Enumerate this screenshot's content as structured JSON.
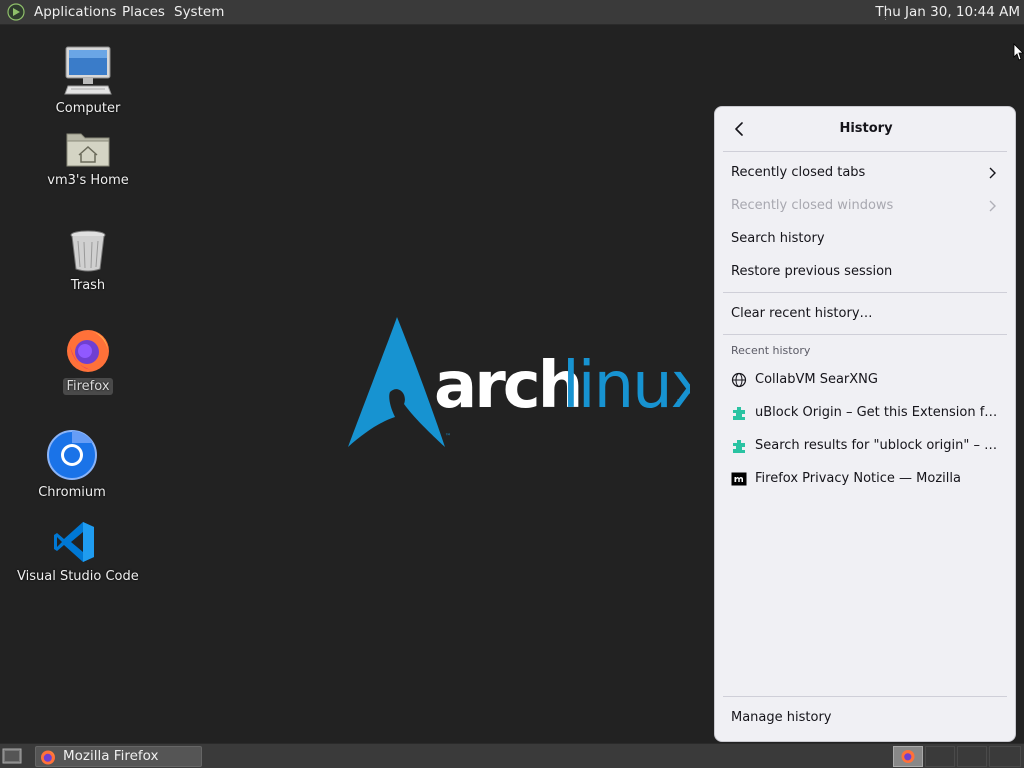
{
  "top_panel": {
    "menu": [
      "Applications",
      "Places",
      "System"
    ],
    "clock": "Thu Jan 30, 10:44 AM"
  },
  "desktop": {
    "icons": [
      {
        "label": "Computer",
        "icon": "computer-icon"
      },
      {
        "label": "vm3's Home",
        "icon": "home-folder-icon"
      },
      {
        "label": "Trash",
        "icon": "trash-icon"
      },
      {
        "label": "Firefox",
        "icon": "firefox-icon"
      },
      {
        "label": "Chromium",
        "icon": "chromium-icon"
      },
      {
        "label": "Visual Studio Code",
        "icon": "vscode-icon"
      }
    ],
    "wallpaper": {
      "logo_arch": "arch",
      "logo_linux": "linux",
      "trademark": "™"
    }
  },
  "history_panel": {
    "title": "History",
    "items": [
      {
        "label": "Recently closed tabs",
        "enabled": true,
        "submenu": true
      },
      {
        "label": "Recently closed windows",
        "enabled": false,
        "submenu": true
      },
      {
        "label": "Search history",
        "enabled": true
      },
      {
        "label": "Restore previous session",
        "enabled": true
      },
      {
        "label": "Clear recent history…",
        "enabled": true
      }
    ],
    "recent_label": "Recent history",
    "recent": [
      {
        "label": "CollabVM SearXNG",
        "icon": "globe-icon"
      },
      {
        "label": "uBlock Origin – Get this Extension for …",
        "icon": "addons-puzzle-icon"
      },
      {
        "label": "Search results for \"ublock origin\" – Add…",
        "icon": "addons-puzzle-icon"
      },
      {
        "label": "Firefox Privacy Notice — Mozilla",
        "icon": "mozilla-m-icon"
      }
    ],
    "manage": "Manage history"
  },
  "bottom_panel": {
    "task_label": "Mozilla Firefox"
  },
  "colors": {
    "desktop_bg": "#222222",
    "panel_bg": "#3a3a3a",
    "arch_blue": "#1793d1",
    "menu_bg": "#f0f0f4"
  }
}
